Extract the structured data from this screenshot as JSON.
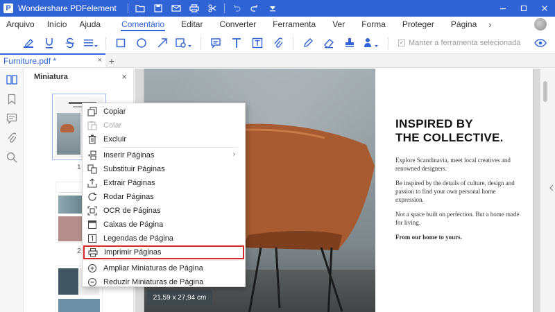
{
  "app": {
    "title": "Wondershare PDFelement",
    "logo_letter": "P"
  },
  "menu": {
    "items": [
      "Arquivo",
      "Início",
      "Ajuda",
      "Comentário",
      "Editar",
      "Converter",
      "Ferramenta",
      "Ver",
      "Forma",
      "Proteger",
      "Página"
    ],
    "active": "Comentário",
    "more_glyph": "›"
  },
  "toolbar": {
    "keep_tool_label": "Manter a ferramenta selecionada"
  },
  "tabs": {
    "doc_tab_label": "Furniture.pdf *",
    "close_glyph": "×",
    "add_glyph": "+"
  },
  "thumbnails": {
    "panel_title": "Miniatura",
    "close_glyph": "×",
    "page_numbers": [
      "1",
      "2"
    ]
  },
  "document": {
    "heading_line1": "INSPIRED BY",
    "heading_line2": "THE COLLECTIVE.",
    "para1": "Explore Scandinavia, meet local creatives and renowned designers.",
    "para2": "Be inspired by the details of culture, design and passion to find your own personal home expression.",
    "para3": "Not a space built on perfection. But a home made for living.",
    "para4": "From our home to yours.",
    "page_size_label": "21,59 x 27,94 cm"
  },
  "context_menu": {
    "items": [
      {
        "label": "Copiar",
        "icon": "copy-icon",
        "enabled": true
      },
      {
        "label": "Colar",
        "icon": "paste-icon",
        "enabled": false
      },
      {
        "label": "Excluir",
        "icon": "trash-icon",
        "enabled": true
      },
      {
        "label": "Inserir Páginas",
        "icon": "insert-pages-icon",
        "enabled": true,
        "submenu": true
      },
      {
        "label": "Substituir Páginas",
        "icon": "replace-pages-icon",
        "enabled": true
      },
      {
        "label": "Extrair Páginas",
        "icon": "extract-pages-icon",
        "enabled": true
      },
      {
        "label": "Rodar Páginas",
        "icon": "rotate-icon",
        "enabled": true
      },
      {
        "label": "OCR de Páginas",
        "icon": "ocr-icon",
        "enabled": true
      },
      {
        "label": "Caixas de Página",
        "icon": "page-boxes-icon",
        "enabled": true
      },
      {
        "label": "Legendas de Página",
        "icon": "page-labels-icon",
        "enabled": true
      },
      {
        "label": "Imprimir Páginas",
        "icon": "print-icon",
        "enabled": true,
        "highlighted": true
      },
      {
        "label": "Ampliar Miniaturas de Página",
        "icon": "zoom-in-icon",
        "enabled": true
      },
      {
        "label": "Reduzir Miniaturas de Página",
        "icon": "zoom-out-icon",
        "enabled": true
      }
    ],
    "submenu_glyph": "›"
  },
  "colors": {
    "brand": "#2f63d6",
    "highlight_outline": "#d8262f"
  }
}
